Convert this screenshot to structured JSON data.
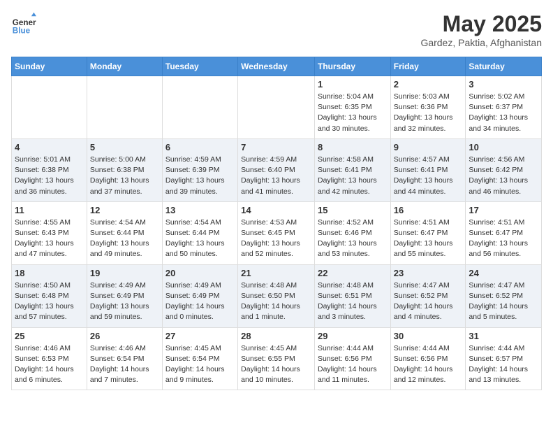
{
  "logo": {
    "line1": "General",
    "line2": "Blue"
  },
  "title": "May 2025",
  "subtitle": "Gardez, Paktia, Afghanistan",
  "days_of_week": [
    "Sunday",
    "Monday",
    "Tuesday",
    "Wednesday",
    "Thursday",
    "Friday",
    "Saturday"
  ],
  "weeks": [
    [
      {
        "day": "",
        "info": ""
      },
      {
        "day": "",
        "info": ""
      },
      {
        "day": "",
        "info": ""
      },
      {
        "day": "",
        "info": ""
      },
      {
        "day": "1",
        "info": "Sunrise: 5:04 AM\nSunset: 6:35 PM\nDaylight: 13 hours\nand 30 minutes."
      },
      {
        "day": "2",
        "info": "Sunrise: 5:03 AM\nSunset: 6:36 PM\nDaylight: 13 hours\nand 32 minutes."
      },
      {
        "day": "3",
        "info": "Sunrise: 5:02 AM\nSunset: 6:37 PM\nDaylight: 13 hours\nand 34 minutes."
      }
    ],
    [
      {
        "day": "4",
        "info": "Sunrise: 5:01 AM\nSunset: 6:38 PM\nDaylight: 13 hours\nand 36 minutes."
      },
      {
        "day": "5",
        "info": "Sunrise: 5:00 AM\nSunset: 6:38 PM\nDaylight: 13 hours\nand 37 minutes."
      },
      {
        "day": "6",
        "info": "Sunrise: 4:59 AM\nSunset: 6:39 PM\nDaylight: 13 hours\nand 39 minutes."
      },
      {
        "day": "7",
        "info": "Sunrise: 4:59 AM\nSunset: 6:40 PM\nDaylight: 13 hours\nand 41 minutes."
      },
      {
        "day": "8",
        "info": "Sunrise: 4:58 AM\nSunset: 6:41 PM\nDaylight: 13 hours\nand 42 minutes."
      },
      {
        "day": "9",
        "info": "Sunrise: 4:57 AM\nSunset: 6:41 PM\nDaylight: 13 hours\nand 44 minutes."
      },
      {
        "day": "10",
        "info": "Sunrise: 4:56 AM\nSunset: 6:42 PM\nDaylight: 13 hours\nand 46 minutes."
      }
    ],
    [
      {
        "day": "11",
        "info": "Sunrise: 4:55 AM\nSunset: 6:43 PM\nDaylight: 13 hours\nand 47 minutes."
      },
      {
        "day": "12",
        "info": "Sunrise: 4:54 AM\nSunset: 6:44 PM\nDaylight: 13 hours\nand 49 minutes."
      },
      {
        "day": "13",
        "info": "Sunrise: 4:54 AM\nSunset: 6:44 PM\nDaylight: 13 hours\nand 50 minutes."
      },
      {
        "day": "14",
        "info": "Sunrise: 4:53 AM\nSunset: 6:45 PM\nDaylight: 13 hours\nand 52 minutes."
      },
      {
        "day": "15",
        "info": "Sunrise: 4:52 AM\nSunset: 6:46 PM\nDaylight: 13 hours\nand 53 minutes."
      },
      {
        "day": "16",
        "info": "Sunrise: 4:51 AM\nSunset: 6:47 PM\nDaylight: 13 hours\nand 55 minutes."
      },
      {
        "day": "17",
        "info": "Sunrise: 4:51 AM\nSunset: 6:47 PM\nDaylight: 13 hours\nand 56 minutes."
      }
    ],
    [
      {
        "day": "18",
        "info": "Sunrise: 4:50 AM\nSunset: 6:48 PM\nDaylight: 13 hours\nand 57 minutes."
      },
      {
        "day": "19",
        "info": "Sunrise: 4:49 AM\nSunset: 6:49 PM\nDaylight: 13 hours\nand 59 minutes."
      },
      {
        "day": "20",
        "info": "Sunrise: 4:49 AM\nSunset: 6:49 PM\nDaylight: 14 hours\nand 0 minutes."
      },
      {
        "day": "21",
        "info": "Sunrise: 4:48 AM\nSunset: 6:50 PM\nDaylight: 14 hours\nand 1 minute."
      },
      {
        "day": "22",
        "info": "Sunrise: 4:48 AM\nSunset: 6:51 PM\nDaylight: 14 hours\nand 3 minutes."
      },
      {
        "day": "23",
        "info": "Sunrise: 4:47 AM\nSunset: 6:52 PM\nDaylight: 14 hours\nand 4 minutes."
      },
      {
        "day": "24",
        "info": "Sunrise: 4:47 AM\nSunset: 6:52 PM\nDaylight: 14 hours\nand 5 minutes."
      }
    ],
    [
      {
        "day": "25",
        "info": "Sunrise: 4:46 AM\nSunset: 6:53 PM\nDaylight: 14 hours\nand 6 minutes."
      },
      {
        "day": "26",
        "info": "Sunrise: 4:46 AM\nSunset: 6:54 PM\nDaylight: 14 hours\nand 7 minutes."
      },
      {
        "day": "27",
        "info": "Sunrise: 4:45 AM\nSunset: 6:54 PM\nDaylight: 14 hours\nand 9 minutes."
      },
      {
        "day": "28",
        "info": "Sunrise: 4:45 AM\nSunset: 6:55 PM\nDaylight: 14 hours\nand 10 minutes."
      },
      {
        "day": "29",
        "info": "Sunrise: 4:44 AM\nSunset: 6:56 PM\nDaylight: 14 hours\nand 11 minutes."
      },
      {
        "day": "30",
        "info": "Sunrise: 4:44 AM\nSunset: 6:56 PM\nDaylight: 14 hours\nand 12 minutes."
      },
      {
        "day": "31",
        "info": "Sunrise: 4:44 AM\nSunset: 6:57 PM\nDaylight: 14 hours\nand 13 minutes."
      }
    ]
  ]
}
